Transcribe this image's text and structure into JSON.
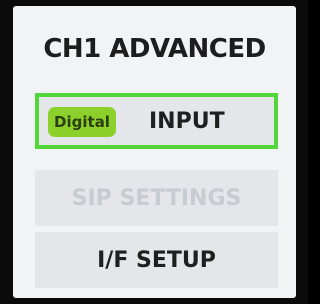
{
  "header": {
    "title": "CH1 ADVANCED"
  },
  "menu": {
    "input": {
      "badge": "Digital",
      "label": "INPUT",
      "selected": true,
      "highlight_color": "#52d63a",
      "badge_color": "#8bd02b"
    },
    "sip_settings": {
      "label": "SIP SETTINGS",
      "disabled": true
    },
    "if_setup": {
      "label": "I/F SETUP"
    }
  }
}
